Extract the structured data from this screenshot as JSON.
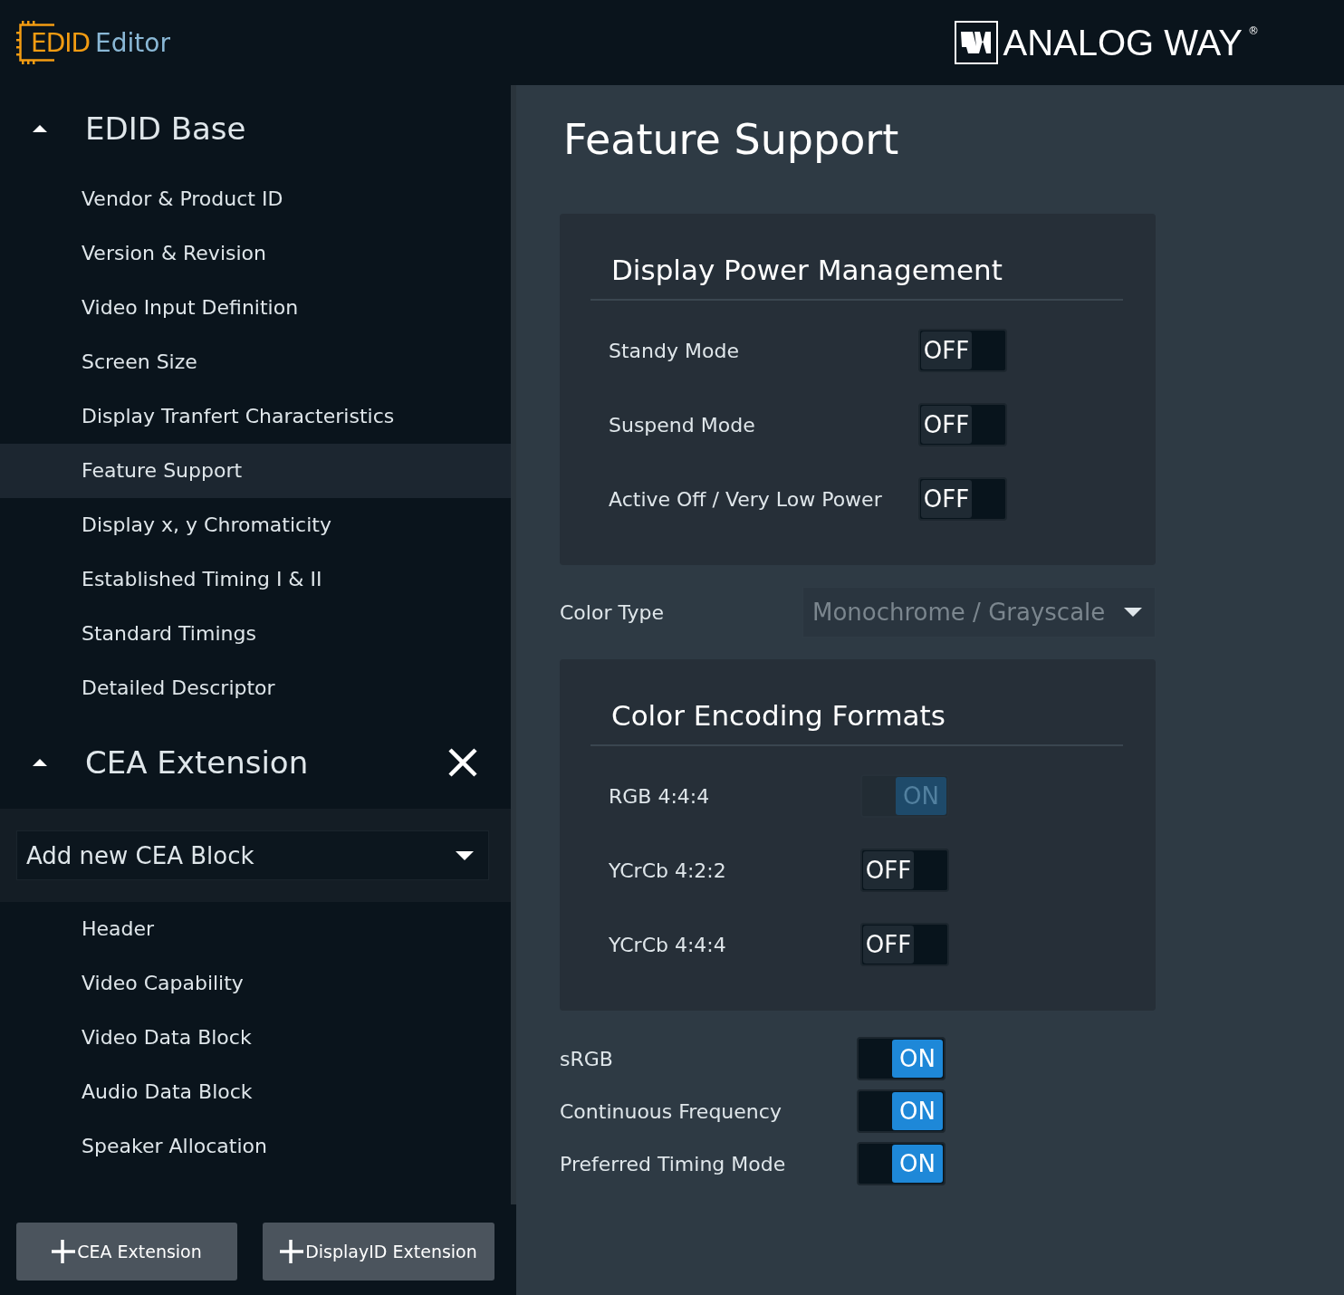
{
  "header": {
    "logo_text": "EDID",
    "app_name": "Editor",
    "brand": "ANALOG WAY",
    "brand_mark": "®"
  },
  "sidebar": {
    "sections": [
      {
        "title": "EDID Base",
        "expanded": true,
        "removable": false,
        "items": [
          {
            "label": "Vendor & Product ID",
            "selected": false
          },
          {
            "label": "Version & Revision",
            "selected": false
          },
          {
            "label": "Video Input Definition",
            "selected": false
          },
          {
            "label": "Screen Size",
            "selected": false
          },
          {
            "label": "Display Tranfert Characteristics",
            "selected": false
          },
          {
            "label": "Feature Support",
            "selected": true
          },
          {
            "label": "Display x, y Chromaticity",
            "selected": false
          },
          {
            "label": "Established Timing I & II",
            "selected": false
          },
          {
            "label": "Standard Timings",
            "selected": false
          },
          {
            "label": "Detailed Descriptor",
            "selected": false
          }
        ]
      },
      {
        "title": "CEA Extension",
        "expanded": true,
        "removable": true,
        "add_block": {
          "placeholder": "Add new CEA Block"
        },
        "items": [
          {
            "label": "Header",
            "selected": false
          },
          {
            "label": "Video Capability",
            "selected": false
          },
          {
            "label": "Video Data Block",
            "selected": false
          },
          {
            "label": "Audio Data Block",
            "selected": false
          },
          {
            "label": "Speaker Allocation",
            "selected": false
          }
        ]
      }
    ],
    "buttons": [
      "CEA Extension",
      "DisplayID Extension"
    ]
  },
  "main": {
    "title": "Feature Support",
    "blocks": [
      {
        "kind": "panel",
        "title": "Display Power Management",
        "rows": [
          {
            "label": "Standy Mode",
            "on": false,
            "disabled": false,
            "text": "OFF"
          },
          {
            "label": "Suspend Mode",
            "on": false,
            "disabled": false,
            "text": "OFF"
          },
          {
            "label": "Active Off / Very Low Power",
            "on": false,
            "disabled": false,
            "text": "OFF"
          }
        ]
      },
      {
        "kind": "select",
        "label": "Color Type",
        "value": "Monochrome / Grayscale",
        "disabled": true
      },
      {
        "kind": "panel",
        "title": "Color Encoding Formats",
        "rows": [
          {
            "label": "RGB 4:4:4",
            "on": true,
            "disabled": true,
            "text": "ON"
          },
          {
            "label": "YCrCb 4:2:2",
            "on": false,
            "disabled": false,
            "text": "OFF"
          },
          {
            "label": "YCrCb 4:4:4",
            "on": false,
            "disabled": false,
            "text": "OFF"
          }
        ]
      },
      {
        "kind": "toggle",
        "label": "sRGB",
        "on": true,
        "disabled": false,
        "text": "ON"
      },
      {
        "kind": "toggle",
        "label": "Continuous Frequency",
        "on": true,
        "disabled": false,
        "text": "ON"
      },
      {
        "kind": "toggle",
        "label": "Preferred Timing Mode",
        "on": true,
        "disabled": false,
        "text": "ON"
      }
    ]
  }
}
